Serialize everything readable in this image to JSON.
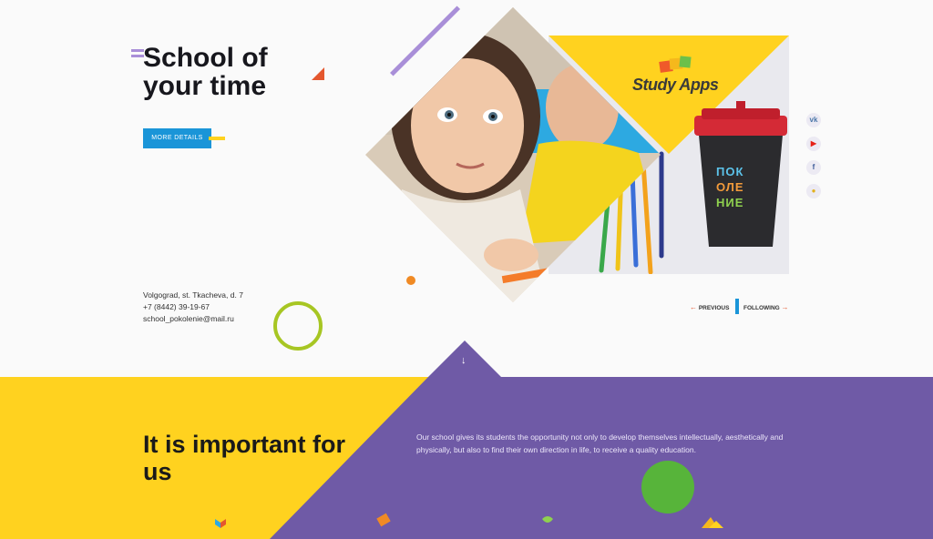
{
  "hero": {
    "title_line1": "School of",
    "title_line2": "your time",
    "more_button": "MORE DETAILS"
  },
  "contacts": {
    "address": "Volgograd, st. Tkacheva, d. 7",
    "phone": "+7 (8442) 39-19-67",
    "email": "school_pokolenie@mail.ru"
  },
  "logo": {
    "text": "Study Apps"
  },
  "cup_text": [
    "ПОК",
    "ОЛЕ",
    "НИЕ"
  ],
  "social": [
    {
      "name": "vk",
      "glyph": "vk",
      "color": "#4a76a8"
    },
    {
      "name": "youtube",
      "glyph": "▶",
      "color": "#e62117"
    },
    {
      "name": "facebook",
      "glyph": "f",
      "color": "#3b5998"
    },
    {
      "name": "other",
      "glyph": "●",
      "color": "#e2b11f"
    }
  ],
  "nav": {
    "previous": "PREVIOUS",
    "following": "FOLLOWING"
  },
  "section2": {
    "heading_line1": "It is important for",
    "heading_line2": "us",
    "text": "Our school gives its students the opportunity not only to develop themselves intellectually, aesthetically and physically, but also to find their own direction in life, to receive a quality education."
  },
  "colors": {
    "yellow": "#ffd21f",
    "purple": "#6f5aa6",
    "blue": "#1a95d8",
    "green": "#57b43a",
    "red": "#e4572e",
    "lilac": "#a98fd8"
  }
}
